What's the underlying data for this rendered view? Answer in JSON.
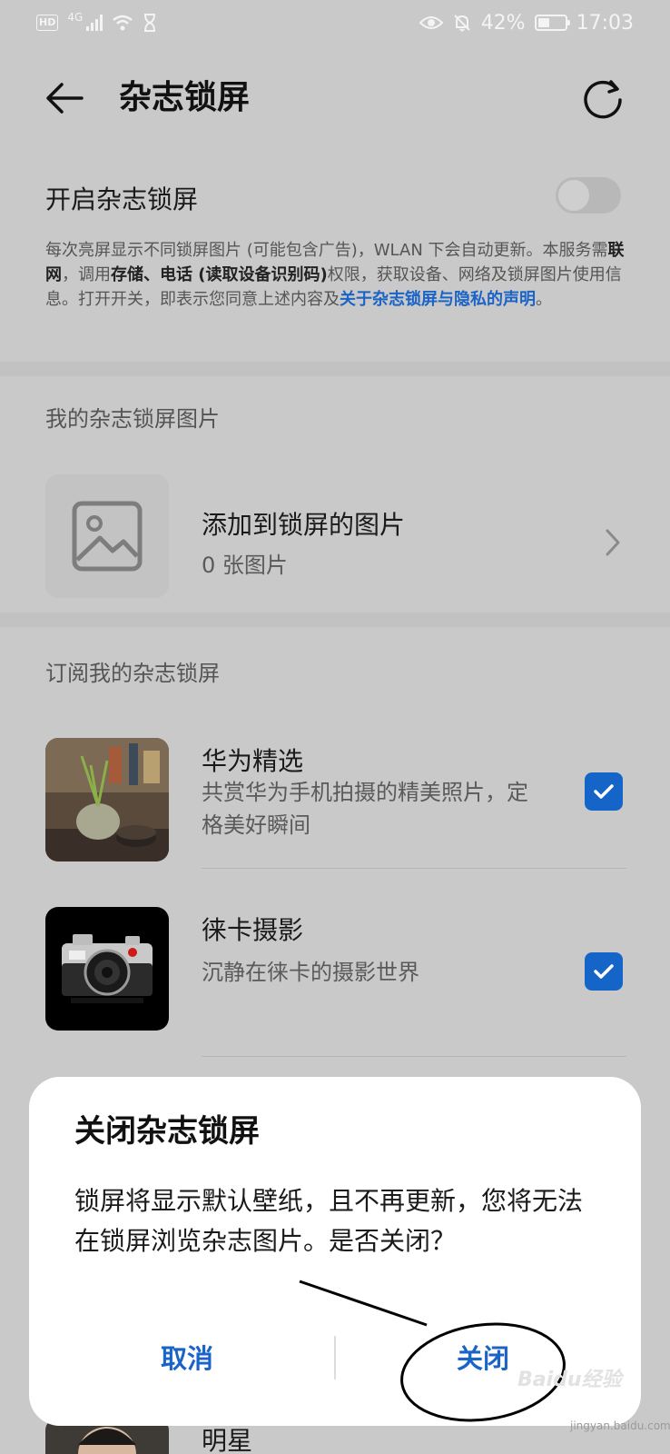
{
  "status_bar": {
    "hd": "HD",
    "network": "4G",
    "battery_percent": "42%",
    "battery_level": 0.42,
    "time": "17:03"
  },
  "app_bar": {
    "title": "杂志锁屏"
  },
  "toggle_row": {
    "label": "开启杂志锁屏",
    "enabled": false
  },
  "description": {
    "p1": "每次亮屏显示不同锁屏图片 (可能包含广告)，WLAN 下会自动更新。本服务需",
    "b1": "联网",
    "p2": "，调用",
    "b2": "存储、电话 (读取设备识别码)",
    "p3": "权限，获取设备、网络及锁屏图片使用信息。打开开关，即表示您同意上述内容及",
    "link": "关于杂志锁屏与隐私的声明",
    "p4": "。"
  },
  "my_pictures": {
    "section_title": "我的杂志锁屏图片",
    "item_title": "添加到锁屏的图片",
    "item_subtitle": "0 张图片"
  },
  "subscriptions": {
    "section_title": "订阅我的杂志锁屏",
    "items": [
      {
        "title": "华为精选",
        "subtitle": "共赏华为手机拍摄的精美照片，定格美好瞬间",
        "checked": true
      },
      {
        "title": "徕卡摄影",
        "subtitle": "沉静在徕卡的摄影世界",
        "checked": true
      },
      {
        "title": "明星",
        "subtitle": ""
      }
    ]
  },
  "dialog": {
    "title": "关闭杂志锁屏",
    "body": "锁屏将显示默认壁纸，且不再更新，您将无法在锁屏浏览杂志图片。是否关闭？",
    "cancel_label": "取消",
    "confirm_label": "关闭"
  },
  "watermark": {
    "logo": "Baidu经验",
    "url": "jingyan.baidu.com"
  },
  "colors": {
    "accent": "#1a64c8",
    "checkbox": "#1565c8",
    "background": "#c9c9c9",
    "dialog": "#ffffff"
  },
  "icons": [
    "hd-icon",
    "signal-icon",
    "wifi-icon",
    "hourglass-icon",
    "eye-icon",
    "mute-bell-icon",
    "battery-icon",
    "back-arrow-icon",
    "refresh-icon",
    "image-placeholder-icon",
    "chevron-right-icon",
    "checkbox-checked-icon"
  ]
}
